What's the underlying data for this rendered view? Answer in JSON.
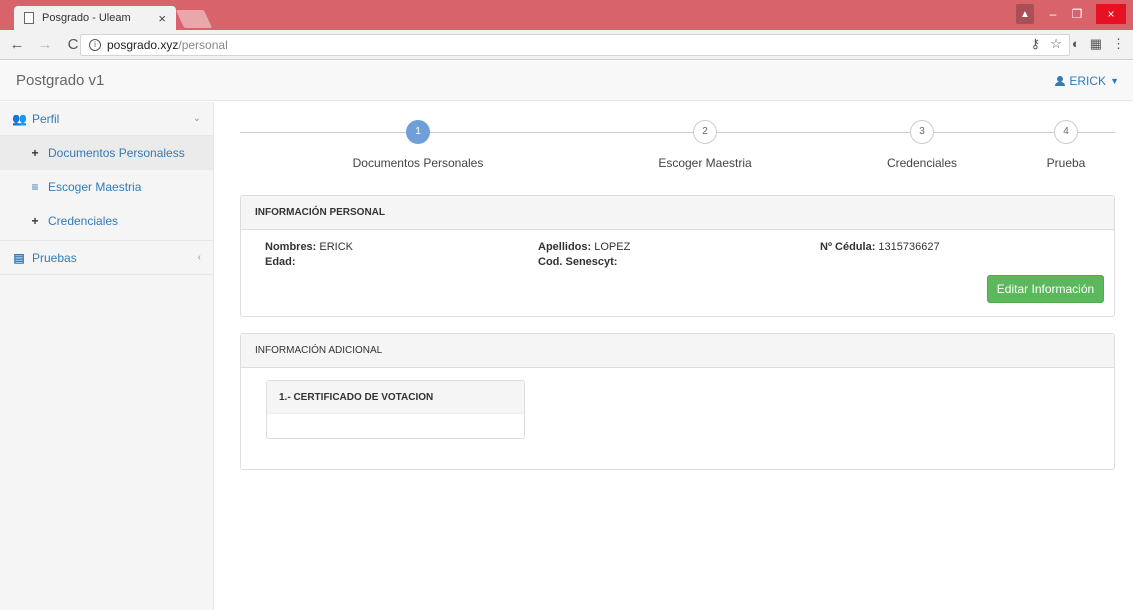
{
  "browser": {
    "tab_title": "Posgrado - Uleam",
    "url_host": "posgrado.xyz",
    "url_path": "/personal"
  },
  "navbar": {
    "brand": "Postgrado v1",
    "user": "ERICK"
  },
  "sidebar": {
    "perfil": "Perfil",
    "items": [
      {
        "label": "Documentos Personaless",
        "glyph": "+"
      },
      {
        "label": "Escoger Maestria",
        "glyph": "≡"
      },
      {
        "label": "Credenciales",
        "glyph": "+"
      }
    ],
    "pruebas": "Pruebas"
  },
  "wizard": {
    "steps": [
      {
        "number": "1",
        "label": "Documentos Personales",
        "active": true
      },
      {
        "number": "2",
        "label": "Escoger Maestria",
        "active": false
      },
      {
        "number": "3",
        "label": "Credenciales",
        "active": false
      },
      {
        "number": "4",
        "label": "Prueba",
        "active": false
      }
    ]
  },
  "personal": {
    "heading": "INFORMACIÓN PERSONAL",
    "nombres_label": "Nombres:",
    "nombres_value": "ERICK",
    "apellidos_label": "Apellidos:",
    "apellidos_value": "LOPEZ",
    "cedula_label": "Nº Cédula:",
    "cedula_value": "1315736627",
    "edad_label": "Edad:",
    "edad_value": "",
    "senescyt_label": "Cod. Senescyt:",
    "senescyt_value": "",
    "edit_button": "Editar Información"
  },
  "adicional": {
    "heading": "INFORMACIÓN ADICIONAL",
    "documents": [
      {
        "title": "1.- CERTIFICADO DE VOTACION"
      }
    ]
  },
  "colors": {
    "titlebar": "#d9636a",
    "link": "#337ab7",
    "success": "#5cb85c",
    "step_active": "#6f9fd8"
  }
}
